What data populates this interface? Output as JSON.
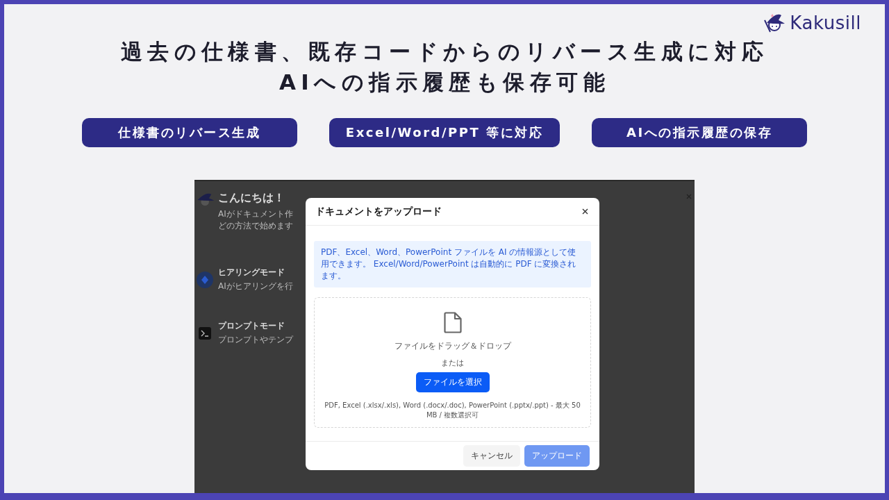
{
  "brand": {
    "name": "Kakusill"
  },
  "headline": [
    "過去の仕様書、既存コードからのリバース生成に対応",
    "AIへの指示履歴も保存可能"
  ],
  "features": [
    {
      "label": "仕様書のリバース生成"
    },
    {
      "label": "Excel/Word/PPT 等に対応"
    },
    {
      "label": "AIへの指示履歴の保存"
    }
  ],
  "app": {
    "greeting": {
      "title": "こんにちは！",
      "lines": [
        "AIがドキュメント作",
        "どの方法で始めます"
      ]
    },
    "modes": [
      {
        "kind": "hearing",
        "title": "ヒアリングモード",
        "description": "AIがヒアリングを行"
      },
      {
        "kind": "prompt",
        "title": "プロンプトモード",
        "description": "プロンプトやテンプ"
      }
    ]
  },
  "dialog": {
    "title": "ドキュメントをアップロード",
    "notice": "PDF、Excel、Word、PowerPoint ファイルを AI の情報源として使用できます。 Excel/Word/PowerPoint は自動的に PDF に変換されます。",
    "dropzone": {
      "prompt": "ファイルをドラッグ＆ドロップ",
      "separator": "または",
      "button": "ファイルを選択",
      "formats": "PDF, Excel (.xlsx/.xls), Word (.docx/.doc), PowerPoint (.pptx/.ppt) - 最大 50 MB / 複数選択可"
    },
    "buttons": [
      {
        "label": "キャンセル",
        "kind": "secondary",
        "disabled": false
      },
      {
        "label": "アップロード",
        "kind": "primary",
        "disabled": true
      }
    ]
  }
}
